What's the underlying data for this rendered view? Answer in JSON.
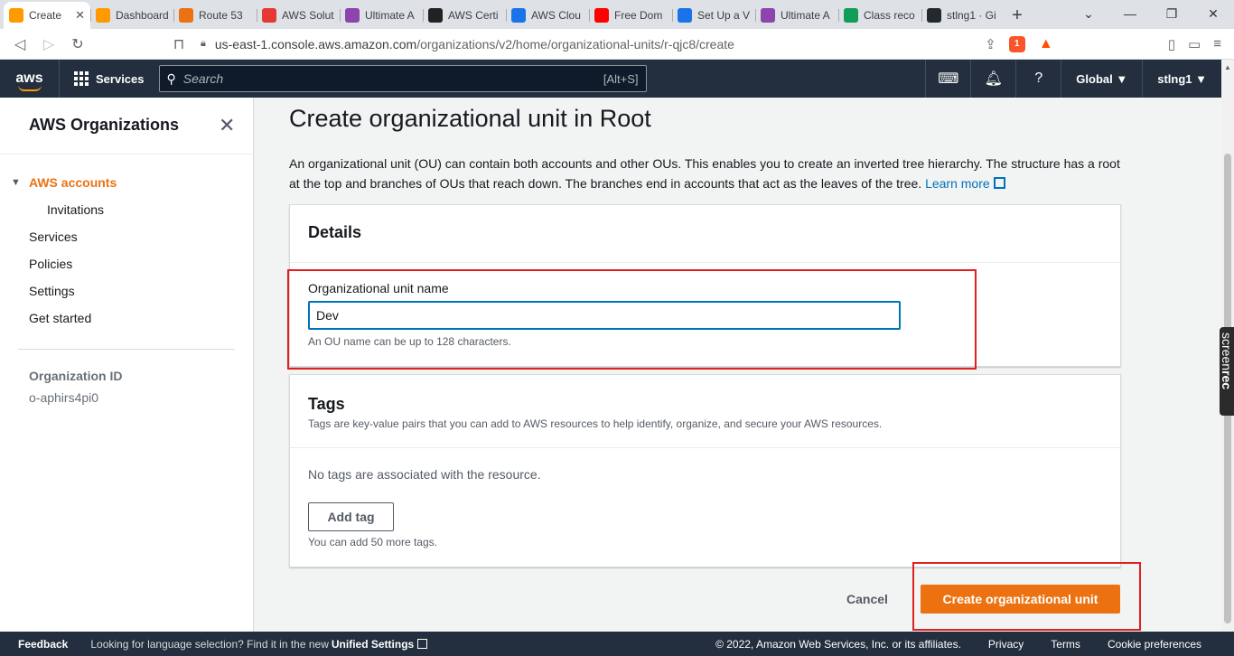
{
  "browser": {
    "tabs": [
      {
        "title": "Create",
        "color": "#ff9900",
        "active": true
      },
      {
        "title": "Dashboard",
        "color": "#ff9900"
      },
      {
        "title": "Route 53",
        "color": "#ec7211"
      },
      {
        "title": "AWS Solut",
        "color": "#e53935"
      },
      {
        "title": "Ultimate A",
        "color": "#8e44ad"
      },
      {
        "title": "AWS Certi",
        "color": "#222222"
      },
      {
        "title": "AWS Clou",
        "color": "#1a73e8"
      },
      {
        "title": "Free Dom",
        "color": "#ff0000"
      },
      {
        "title": "Set Up a V",
        "color": "#1a73e8"
      },
      {
        "title": "Ultimate A",
        "color": "#8e44ad"
      },
      {
        "title": "Class reco",
        "color": "#0f9d58"
      },
      {
        "title": "stlng1 · Gi",
        "color": "#24292e"
      }
    ],
    "url_host": "us-east-1.console.aws.amazon.com",
    "url_path": "/organizations/v2/home/organizational-units/r-qjc8/create",
    "badge_count": "1"
  },
  "topnav": {
    "logo": "aws",
    "services_label": "Services",
    "search_placeholder": "Search",
    "search_shortcut": "[Alt+S]",
    "region": "Global ▼",
    "account": "stlng1 ▼"
  },
  "sidebar": {
    "title": "AWS Organizations",
    "items": [
      "AWS accounts",
      "Invitations",
      "Services",
      "Policies",
      "Settings",
      "Get started"
    ],
    "org_id_label": "Organization ID",
    "org_id_value": "o-aphirs4pi0"
  },
  "main": {
    "title": "Create organizational unit in Root",
    "description": "An organizational unit (OU) can contain both accounts and other OUs. This enables you to create an inverted tree hierarchy. The structure has a root at the top and branches of OUs that reach down. The branches end in accounts that act as the leaves of the tree.",
    "learn_more": "Learn more",
    "details": {
      "heading": "Details",
      "field_label": "Organizational unit name",
      "field_value": "Dev",
      "field_hint": "An OU name can be up to 128 characters."
    },
    "tags": {
      "heading": "Tags",
      "description": "Tags are key-value pairs that you can add to AWS resources to help identify, organize, and secure your AWS resources.",
      "empty_text": "No tags are associated with the resource.",
      "add_label": "Add tag",
      "limit_text": "You can add 50 more tags."
    },
    "cancel_label": "Cancel",
    "create_label": "Create organizational unit"
  },
  "footer": {
    "feedback": "Feedback",
    "language_text": "Looking for language selection? Find it in the new",
    "unified_settings": "Unified Settings",
    "copyright": "© 2022, Amazon Web Services, Inc. or its affiliates.",
    "privacy": "Privacy",
    "terms": "Terms",
    "cookie": "Cookie preferences"
  },
  "overlay": {
    "screenrec_a": "screen",
    "screenrec_b": "rec"
  },
  "colors": {
    "accent": "#ec7211",
    "link": "#0073bb",
    "nav_bg": "#232f3e",
    "highlight": "#e02020"
  }
}
